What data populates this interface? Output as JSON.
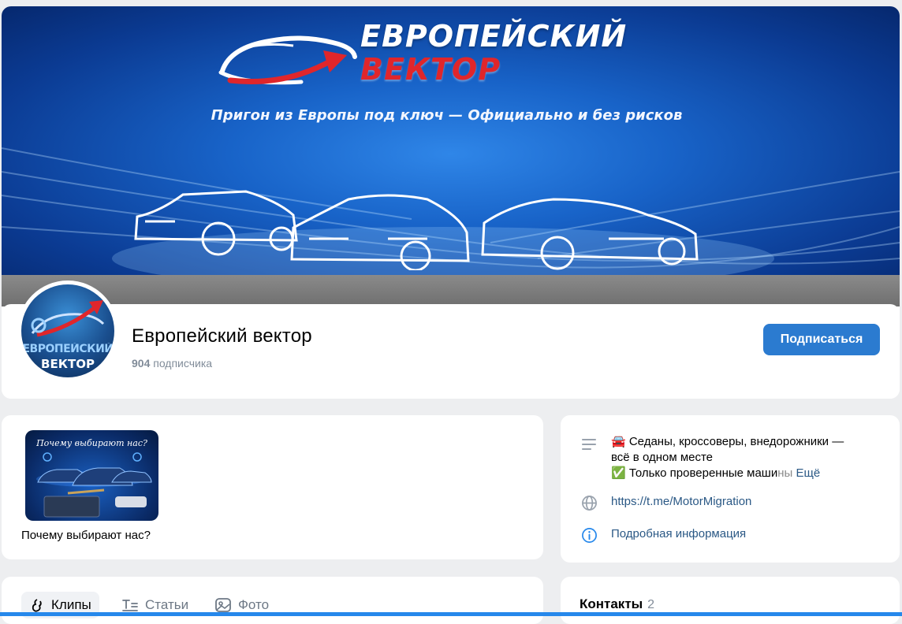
{
  "cover": {
    "brand_title": "ЕВРОПЕЙСКИЙ",
    "brand_subtitle": "ВЕКТОР",
    "slogan": "Пригон из Европы под ключ — Официально и без рисков"
  },
  "profile": {
    "avatar_line1": "ЕВРОПЕЙСКИЙ",
    "avatar_line2": "ВЕКТОР",
    "name": "Европейский вектор",
    "subscribers_count": "904",
    "subscribers_label": "подписчика",
    "subscribe_button": "Подписаться"
  },
  "clip": {
    "thumb_title": "Почему выбирают нас?",
    "label": "Почему выбирают нас?"
  },
  "info": {
    "desc_line1": "🚘 Седаны, кроссоверы, внедорожники —",
    "desc_line2": "всё в одном месте",
    "desc_line3_main": "✅ Только проверенные маши",
    "desc_line3_fade": "ны",
    "desc_more": "Ещё",
    "link": "https://t.me/MotorMigration",
    "more_info": "Подробная информация"
  },
  "tabs": [
    {
      "label": "Клипы",
      "icon": "clips-icon",
      "active": true
    },
    {
      "label": "Статьи",
      "icon": "articles-icon",
      "active": false
    },
    {
      "label": "Фото",
      "icon": "photo-icon",
      "active": false
    }
  ],
  "contacts": {
    "title": "Контакты",
    "count": "2"
  },
  "colors": {
    "accent": "#2b7bd0",
    "link": "#2a5885",
    "background": "#edeef0",
    "brand_red": "#e0262b"
  }
}
